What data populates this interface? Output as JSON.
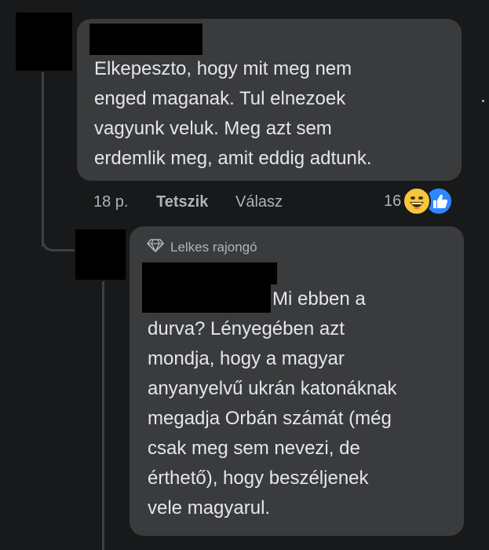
{
  "comment1": {
    "text": "Elkepeszto, hogy mit meg nem\nenged maganak. Tul elnezoek\nvagyunk veluk. Meg azt sem\nerdemlik meg, amit eddig adtunk.",
    "time": "18 p.",
    "like_label": "Tetszik",
    "reply_label": "Válasz",
    "reaction_count": "16",
    "reactions": [
      "laughing-emoji-icon",
      "like-icon"
    ]
  },
  "reply1": {
    "badge": "Lelkes rajongó",
    "text_first": "Mi ebben a",
    "text_rest": "durva? Lényegében azt\nmondja, hogy a magyar\nanyanyelvű ukrán katonáknak\nmegadja Orbán számát (még\ncsak meg sem nevezi, de\nérthető), hogy beszéljenek\nvele magyarul."
  },
  "colors": {
    "background": "#18191a",
    "bubble": "#3a3b3c",
    "text": "#e4e6eb",
    "meta": "#b0b3b8",
    "like_blue": "#2d88ff",
    "haha_yellow": "#f7c73b"
  }
}
